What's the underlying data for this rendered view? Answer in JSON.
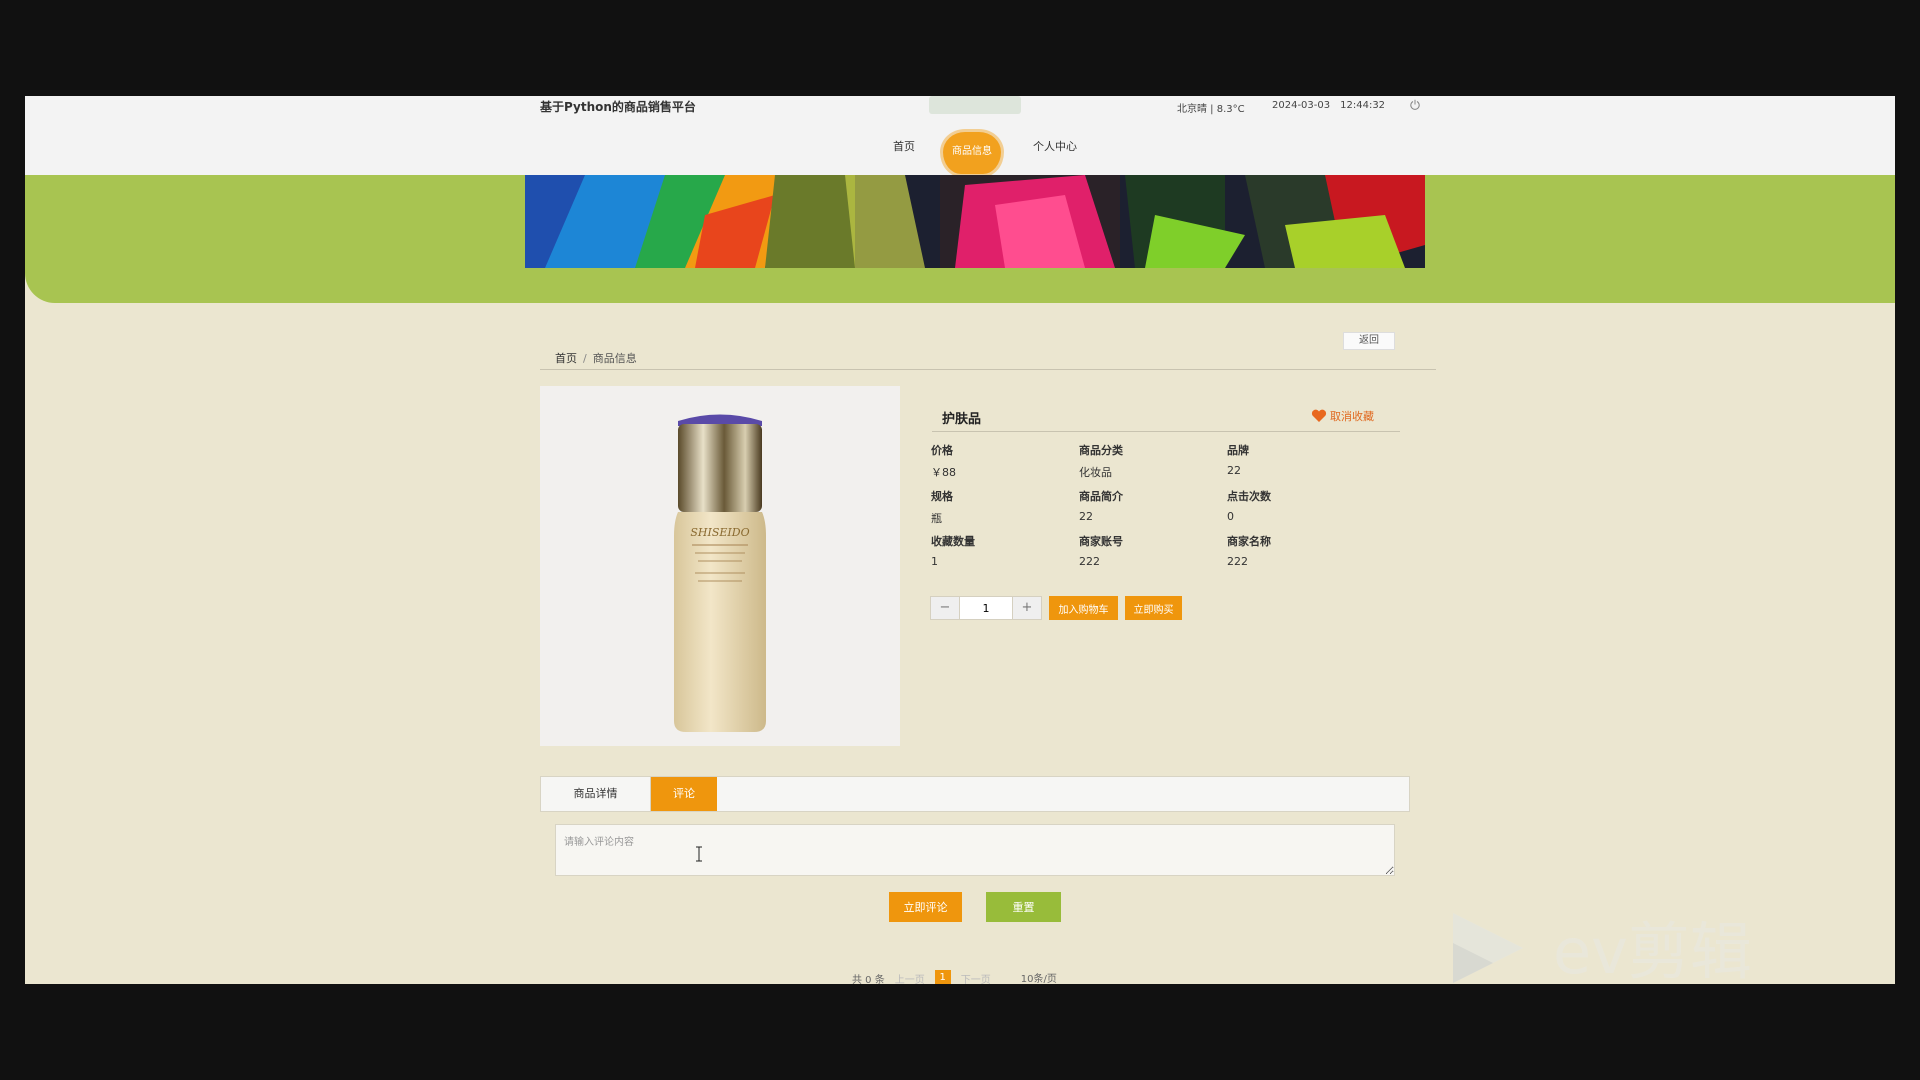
{
  "header": {
    "site_title": "基于Python的商品销售平台",
    "weather": "北京晴 | 8.3°C",
    "date": "2024-03-03",
    "time": "12:44:32"
  },
  "nav": {
    "home": "首页",
    "product_info": "商品信息",
    "personal_center": "个人中心"
  },
  "breadcrumb": {
    "home": "首页",
    "separator": "/",
    "current": "商品信息",
    "back": "返回"
  },
  "product": {
    "name": "护肤品",
    "unfavorite": "取消收藏",
    "fields": [
      {
        "label": "价格",
        "value": "￥88"
      },
      {
        "label": "商品分类",
        "value": "化妆品"
      },
      {
        "label": "品牌",
        "value": "22"
      },
      {
        "label": "规格",
        "value": "瓶"
      },
      {
        "label": "商品简介",
        "value": "22"
      },
      {
        "label": "点击次数",
        "value": "0"
      },
      {
        "label": "收藏数量",
        "value": "1"
      },
      {
        "label": "商家账号",
        "value": "222"
      },
      {
        "label": "商家名称",
        "value": "222"
      }
    ],
    "quantity": "1",
    "add_to_cart": "加入购物车",
    "buy_now": "立即购买",
    "image_brand": "SHISEIDO"
  },
  "tabs": {
    "detail": "商品详情",
    "comment": "评论"
  },
  "comment": {
    "placeholder": "请输入评论内容",
    "submit": "立即评论",
    "reset": "重置"
  },
  "pagination": {
    "total": "共 0 条",
    "prev": "上一页",
    "current_page": "1",
    "next": "下一页",
    "page_size": "10条/页"
  },
  "watermark": "ev剪辑",
  "colors": {
    "accent_orange": "#ef960d",
    "banner_green": "#a8c451",
    "reset_green": "#98bc3a",
    "page_bg": "#ebe6d0"
  }
}
